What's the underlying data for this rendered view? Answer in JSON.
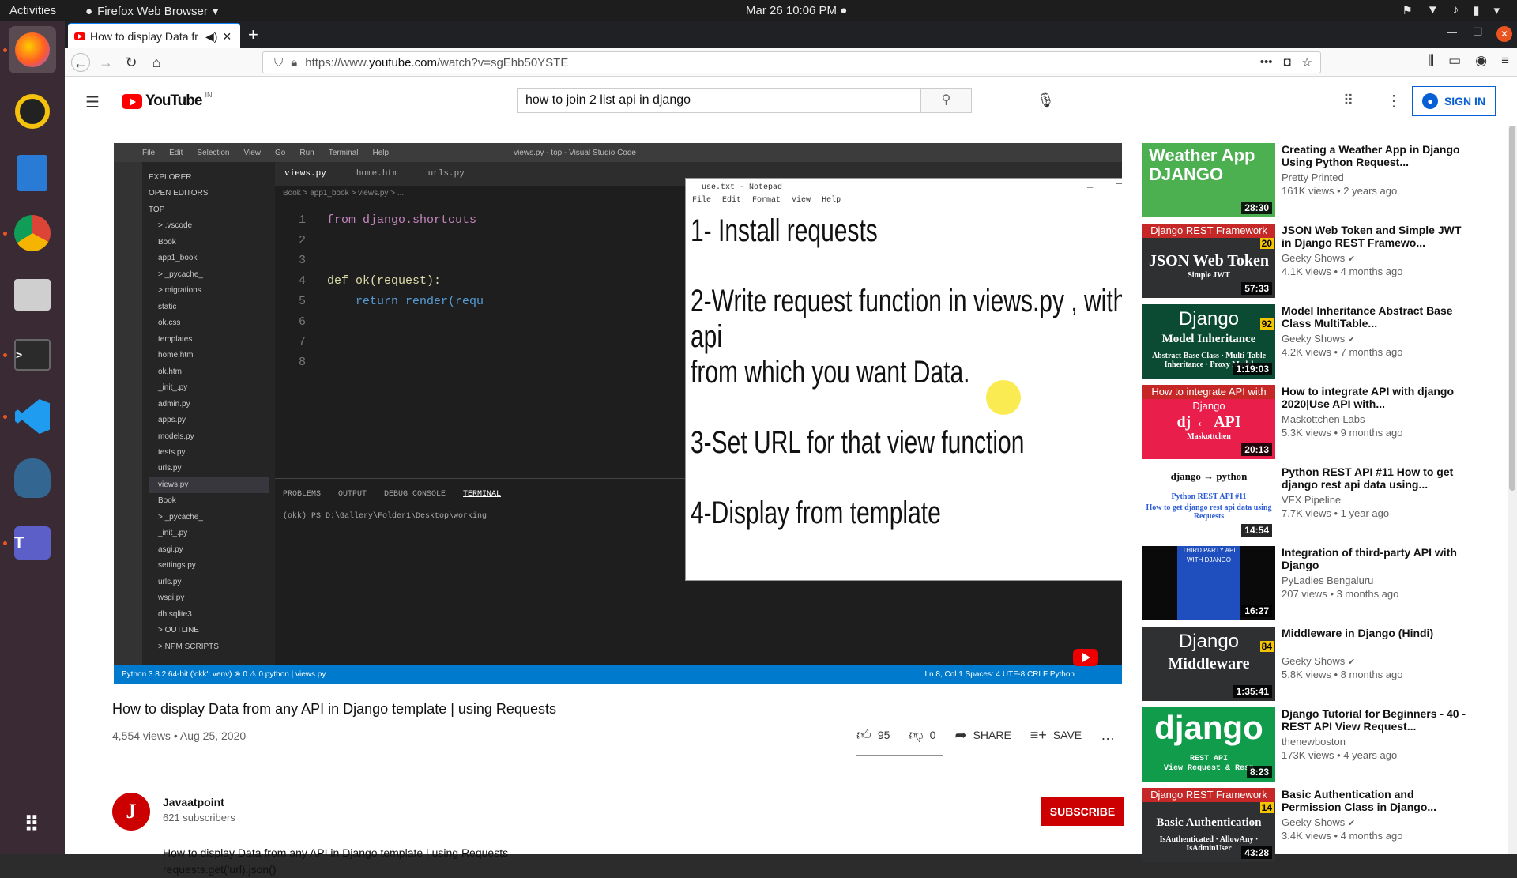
{
  "topbar": {
    "activities": "Activities",
    "app_name": "Firefox Web Browser",
    "clock": "Mar 26  10:06 PM"
  },
  "dock": {
    "items": [
      "firefox-icon",
      "rhythmbox-icon",
      "libreoffice-writer-icon",
      "chrome-icon",
      "files-icon",
      "terminal-icon",
      "vscode-icon",
      "postgres-icon",
      "teams-icon",
      "app-grid-icon"
    ]
  },
  "browser": {
    "tab_title": "How to display Data fr",
    "url_prefix": "https://www.",
    "url_host": "youtube.com",
    "url_path": "/watch?v=sgEhb50YSTE"
  },
  "youtube": {
    "country_code": "IN",
    "search_value": "how to join 2 list api in django",
    "sign_in": "SIGN IN",
    "video": {
      "title": "How to display Data from any API in Django template | using Requests",
      "views": "4,554 views",
      "date": "Aug 25, 2020",
      "likes": "95",
      "dislikes": "0",
      "share": "SHARE",
      "save": "SAVE",
      "channel": "Javaatpoint",
      "subscribers": "621 subscribers",
      "subscribe": "SUBSCRIBE",
      "description_line1": "How to display Data from any API in Django template | using Requests",
      "description_line2": "requests.get('url).json()"
    },
    "frame": {
      "vscode_menu": [
        "File",
        "Edit",
        "Selection",
        "View",
        "Go",
        "Run",
        "Terminal",
        "Help"
      ],
      "vscode_title": "views.py - top - Visual Studio Code",
      "explorer_items": [
        "EXPLORER",
        "OPEN EDITORS",
        "TOP",
        "> .vscode",
        "Book",
        "app1_book",
        "> _pycache_",
        "> migrations",
        "static",
        "ok.css",
        "templates",
        "home.htm",
        "ok.htm",
        "_init_.py",
        "admin.py",
        "apps.py",
        "models.py",
        "tests.py",
        "urls.py",
        "views.py",
        "Book",
        "> _pycache_",
        "_init_.py",
        "asgi.py",
        "settings.py",
        "urls.py",
        "wsgi.py",
        "db.sqlite3",
        "> OUTLINE",
        "> NPM SCRIPTS"
      ],
      "editor_tabs": [
        "views.py",
        "home.htm",
        "urls.py"
      ],
      "breadcrumb": "Book > app1_book > views.py > ...",
      "code_lines": [
        {
          "n": "1",
          "text": "from django.shortcuts"
        },
        {
          "n": "2",
          "text": ""
        },
        {
          "n": "3",
          "text": ""
        },
        {
          "n": "4",
          "text": "def ok(request):"
        },
        {
          "n": "5",
          "text": "    return render(requ"
        },
        {
          "n": "6",
          "text": ""
        },
        {
          "n": "7",
          "text": ""
        },
        {
          "n": "8",
          "text": ""
        }
      ],
      "panel_tabs": [
        "PROBLEMS",
        "OUTPUT",
        "DEBUG CONSOLE",
        "TERMINAL"
      ],
      "terminal_line": "(okk) PS D:\\Gallery\\Folder1\\Desktop\\working_",
      "status_left": "Python 3.8.2 64-bit ('okk': venv)   ⊗ 0 ⚠ 0   python | views.py",
      "status_right": "Ln 8, Col 1   Spaces: 4   UTF-8   CRLF   Python",
      "notepad_title": "use.txt - Notepad",
      "notepad_menu": [
        "File",
        "Edit",
        "Format",
        "View",
        "Help"
      ],
      "notepad_lines": [
        "1- Install requests",
        "2-Write request function in views.py , with api",
        "from which you want Data.",
        "3-Set URL for that view function",
        "4-Display from template"
      ]
    },
    "recommendations": [
      {
        "title": "Creating a Weather App in Django Using Python Request...",
        "channel": "Pretty Printed",
        "verified": false,
        "views": "161K views",
        "age": "2 years ago",
        "duration": "28:30",
        "thumb_text": "Weather App DJANGO",
        "color": "#4caf50"
      },
      {
        "title": "JSON Web Token and Simple JWT in Django REST Framewo...",
        "channel": "Geeky Shows",
        "verified": true,
        "views": "4.1K views",
        "age": "4 months ago",
        "duration": "57:33",
        "band": "Django REST Framework",
        "ep": "20",
        "thumb_text": "JSON Web Token",
        "thumb_sub": "Simple JWT",
        "color": "#2e3032"
      },
      {
        "title": "Model Inheritance Abstract Base Class MultiTable...",
        "channel": "Geeky Shows",
        "verified": true,
        "views": "4.2K views",
        "age": "7 months ago",
        "duration": "1:19:03",
        "band": "Django",
        "ep": "92",
        "thumb_text": "Model Inheritance",
        "thumb_sub": "Abstract Base Class · Multi-Table Inheritance · Proxy Model",
        "color": "#0c4b33"
      },
      {
        "title": "How to integrate API with django 2020|Use API with...",
        "channel": "Maskottchen Labs",
        "verified": false,
        "views": "5.3K views",
        "age": "9 months ago",
        "duration": "20:13",
        "band": "How to integrate API with Django",
        "thumb_text": "dj ← API",
        "thumb_sub": "Maskottchen",
        "color": "#e91e4a"
      },
      {
        "title": "Python REST API #11 How to get django rest api data using...",
        "channel": "VFX Pipeline",
        "verified": false,
        "views": "7.7K views",
        "age": "1 year ago",
        "duration": "14:54",
        "thumb_text": "django → python",
        "thumb_sub": "Python REST API #11",
        "thumb_sub2": "How to get django rest api data using Requests",
        "color": "#ffffff"
      },
      {
        "title": "Integration of third-party API with Django",
        "channel": "PyLadies Bengaluru",
        "verified": false,
        "views": "207 views",
        "age": "3 months ago",
        "duration": "16:27",
        "band": "THIRD PARTY API WITH DJANGO",
        "color": "#0a0a0a"
      },
      {
        "title": "Middleware in Django (Hindi)",
        "channel": "Geeky Shows",
        "verified": true,
        "views": "5.8K views",
        "age": "8 months ago",
        "duration": "1:35:41",
        "band": "Django",
        "ep": "84",
        "thumb_text": "Middleware",
        "color": "#2e3032"
      },
      {
        "title": "Django Tutorial for Beginners - 40 - REST API View Request...",
        "channel": "thenewboston",
        "verified": false,
        "views": "173K views",
        "age": "4 years ago",
        "duration": "8:23",
        "thumb_text": "django",
        "thumb_sub": "REST API",
        "thumb_sub2": "View Request & Resp",
        "color": "#109c4a"
      },
      {
        "title": "Basic Authentication and Permission Class in Django...",
        "channel": "Geeky Shows",
        "verified": true,
        "views": "3.4K views",
        "age": "4 months ago",
        "duration": "43:28",
        "band": "Django REST Framework",
        "ep": "14",
        "thumb_text": "Basic Authentication",
        "thumb_sub": "IsAuthenticated · AllowAny · IsAdminUser",
        "color": "#2e3032"
      }
    ]
  }
}
